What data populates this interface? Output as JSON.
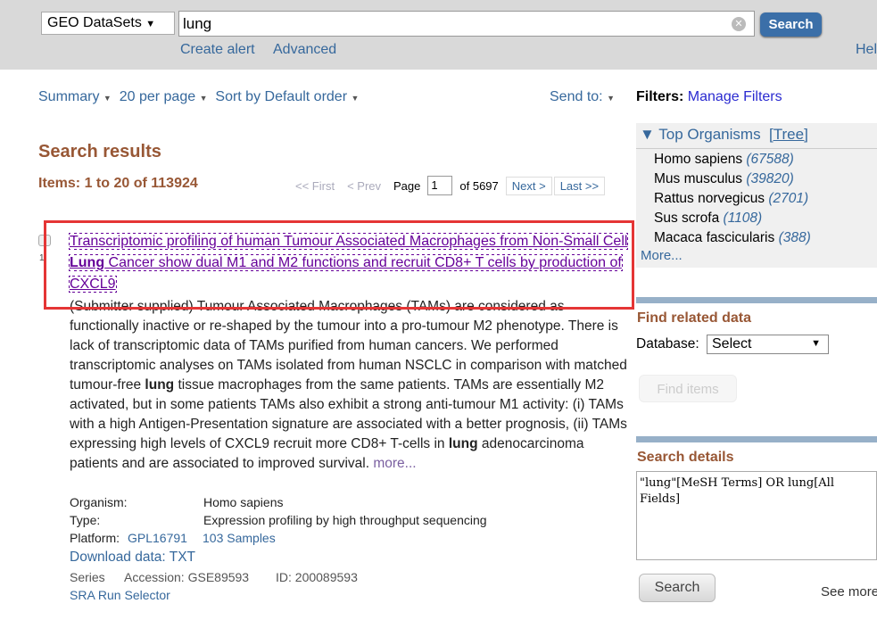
{
  "search": {
    "database": "GEO DataSets",
    "query": "lung",
    "button": "Search",
    "create_alert": "Create alert",
    "advanced": "Advanced",
    "help": "Help"
  },
  "toolbar": {
    "summary": "Summary",
    "per_page": "20 per page",
    "sort": "Sort by Default order",
    "send_to": "Send to:"
  },
  "results": {
    "heading": "Search results",
    "items": "Items: 1 to 20 of 113924",
    "first": "<< First",
    "prev": "< Prev",
    "page_label": "Page",
    "page": "1",
    "of": "of 5697",
    "next": "Next >",
    "last": "Last >>"
  },
  "result": {
    "number": "1.",
    "title_a": "Transcriptomic profiling of human Tumour Associated Macrophages from Non-Small Cell ",
    "title_b": "Lung",
    "title_c": " Cancer show dual M1 and M2 functions and recruit CD8+ T cells by production of CXCL9",
    "desc_a": "(Submitter supplied) Tumour Associated Macrophages (TAMs) are considered as functionally inactive or re-shaped by the tumour into a pro-tumour M2 phenotype. There is lack of transcriptomic data of TAMs purified from human cancers. We performed transcriptomic analyses on TAMs isolated from human NSCLC in comparison with matched tumour-free ",
    "desc_b": "lung",
    "desc_c": " tissue macrophages from the same patients. TAMs are essentially M2 activated, but in some patients TAMs also exhibit a strong anti-tumour M1 activity: (i) TAMs with a high Antigen-Presentation signature are associated with a better prognosis, (ii) TAMs expressing high levels of CXCL9 recruit more CD8+ T-cells in ",
    "desc_d": "lung",
    "desc_e": " adenocarcinoma patients and are associated to improved survival. ",
    "more": "more...",
    "organism_label": "Organism:",
    "organism": "Homo sapiens",
    "type_label": "Type:",
    "type": "Expression profiling by high throughput sequencing",
    "platform_label": "Platform:",
    "platform": "GPL16791",
    "samples": "103 Samples",
    "download": "Download data: TXT",
    "series": "Series",
    "accession": "Accession: GSE89593",
    "id": "ID: 200089593",
    "sra": "SRA Run Selector"
  },
  "sidebar": {
    "filters": "Filters:",
    "manage": "Manage Filters",
    "top_org": "Top Organisms",
    "tree": "[Tree]",
    "organisms": [
      {
        "name": "Homo sapiens",
        "count": "(67588)"
      },
      {
        "name": "Mus musculus",
        "count": "(39820)"
      },
      {
        "name": "Rattus norvegicus",
        "count": "(2701)"
      },
      {
        "name": "Sus scrofa",
        "count": "(1108)"
      },
      {
        "name": "Macaca fascicularis",
        "count": "(388)"
      }
    ],
    "more": "More...",
    "find_related": "Find related data",
    "database_label": "Database:",
    "database_value": "Select",
    "find_items": "Find items",
    "search_details": "Search details",
    "details_query": "\"lung\"[MeSH Terms] OR lung[All Fields]",
    "search_btn": "Search",
    "see_more": "See more"
  }
}
